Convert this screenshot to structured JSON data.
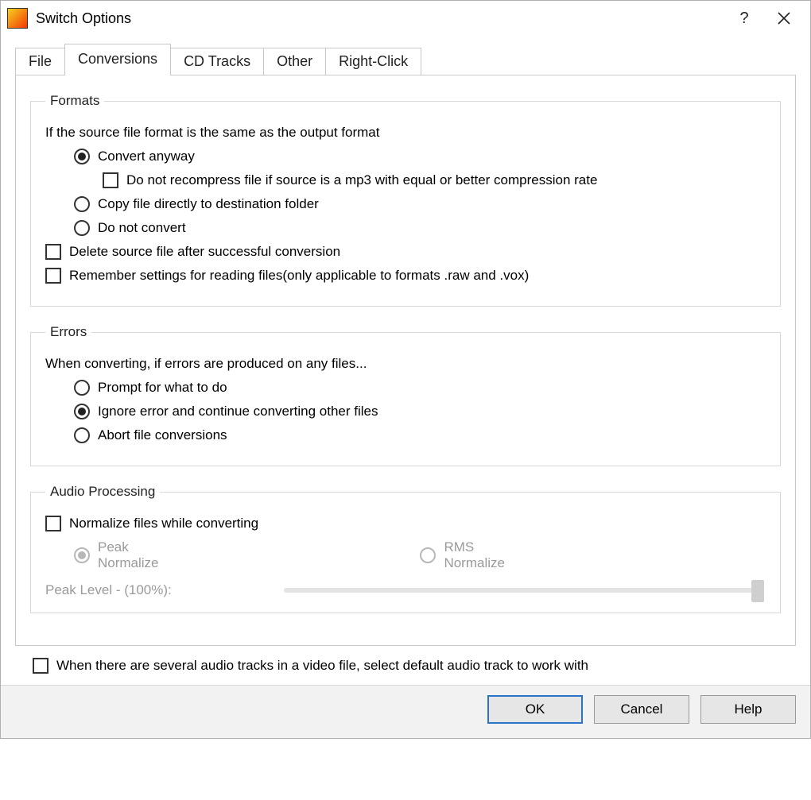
{
  "window": {
    "title": "Switch Options"
  },
  "tabs": {
    "items": [
      "File",
      "Conversions",
      "CD Tracks",
      "Other",
      "Right-Click"
    ],
    "active_index": 1
  },
  "formats": {
    "legend": "Formats",
    "lead": "If the source file format is the same as the output format",
    "radios": {
      "convert_anyway": "Convert anyway",
      "copy_direct": "Copy file directly to destination folder",
      "do_not_convert": "Do not convert",
      "selected": "convert_anyway"
    },
    "sub_checks": {
      "no_recompress": {
        "label": "Do not recompress file if source is a mp3 with equal or better compression rate",
        "checked": false
      }
    },
    "checks": {
      "delete_source": {
        "label": "Delete source file after successful conversion",
        "checked": false
      },
      "remember_settings": {
        "label": "Remember settings for reading files(only applicable to formats .raw and .vox)",
        "checked": false
      }
    }
  },
  "errors": {
    "legend": "Errors",
    "lead": "When converting, if errors are produced on any files...",
    "radios": {
      "prompt": "Prompt for what to do",
      "ignore": "Ignore error and continue converting other files",
      "abort": "Abort file conversions",
      "selected": "ignore"
    }
  },
  "audio": {
    "legend": "Audio Processing",
    "normalize": {
      "label": "Normalize files while converting",
      "checked": false
    },
    "mode": {
      "peak": "Peak Normalize",
      "rms": "RMS Normalize",
      "selected": "peak",
      "enabled": false
    },
    "peak_slider": {
      "label": "Peak Level - (100%):",
      "value": 100,
      "min": 0,
      "max": 100,
      "enabled": false
    }
  },
  "video_tracks": {
    "label": "When there are several audio tracks in a video file, select default audio track to work with",
    "checked": false
  },
  "buttons": {
    "ok": "OK",
    "cancel": "Cancel",
    "help": "Help"
  }
}
